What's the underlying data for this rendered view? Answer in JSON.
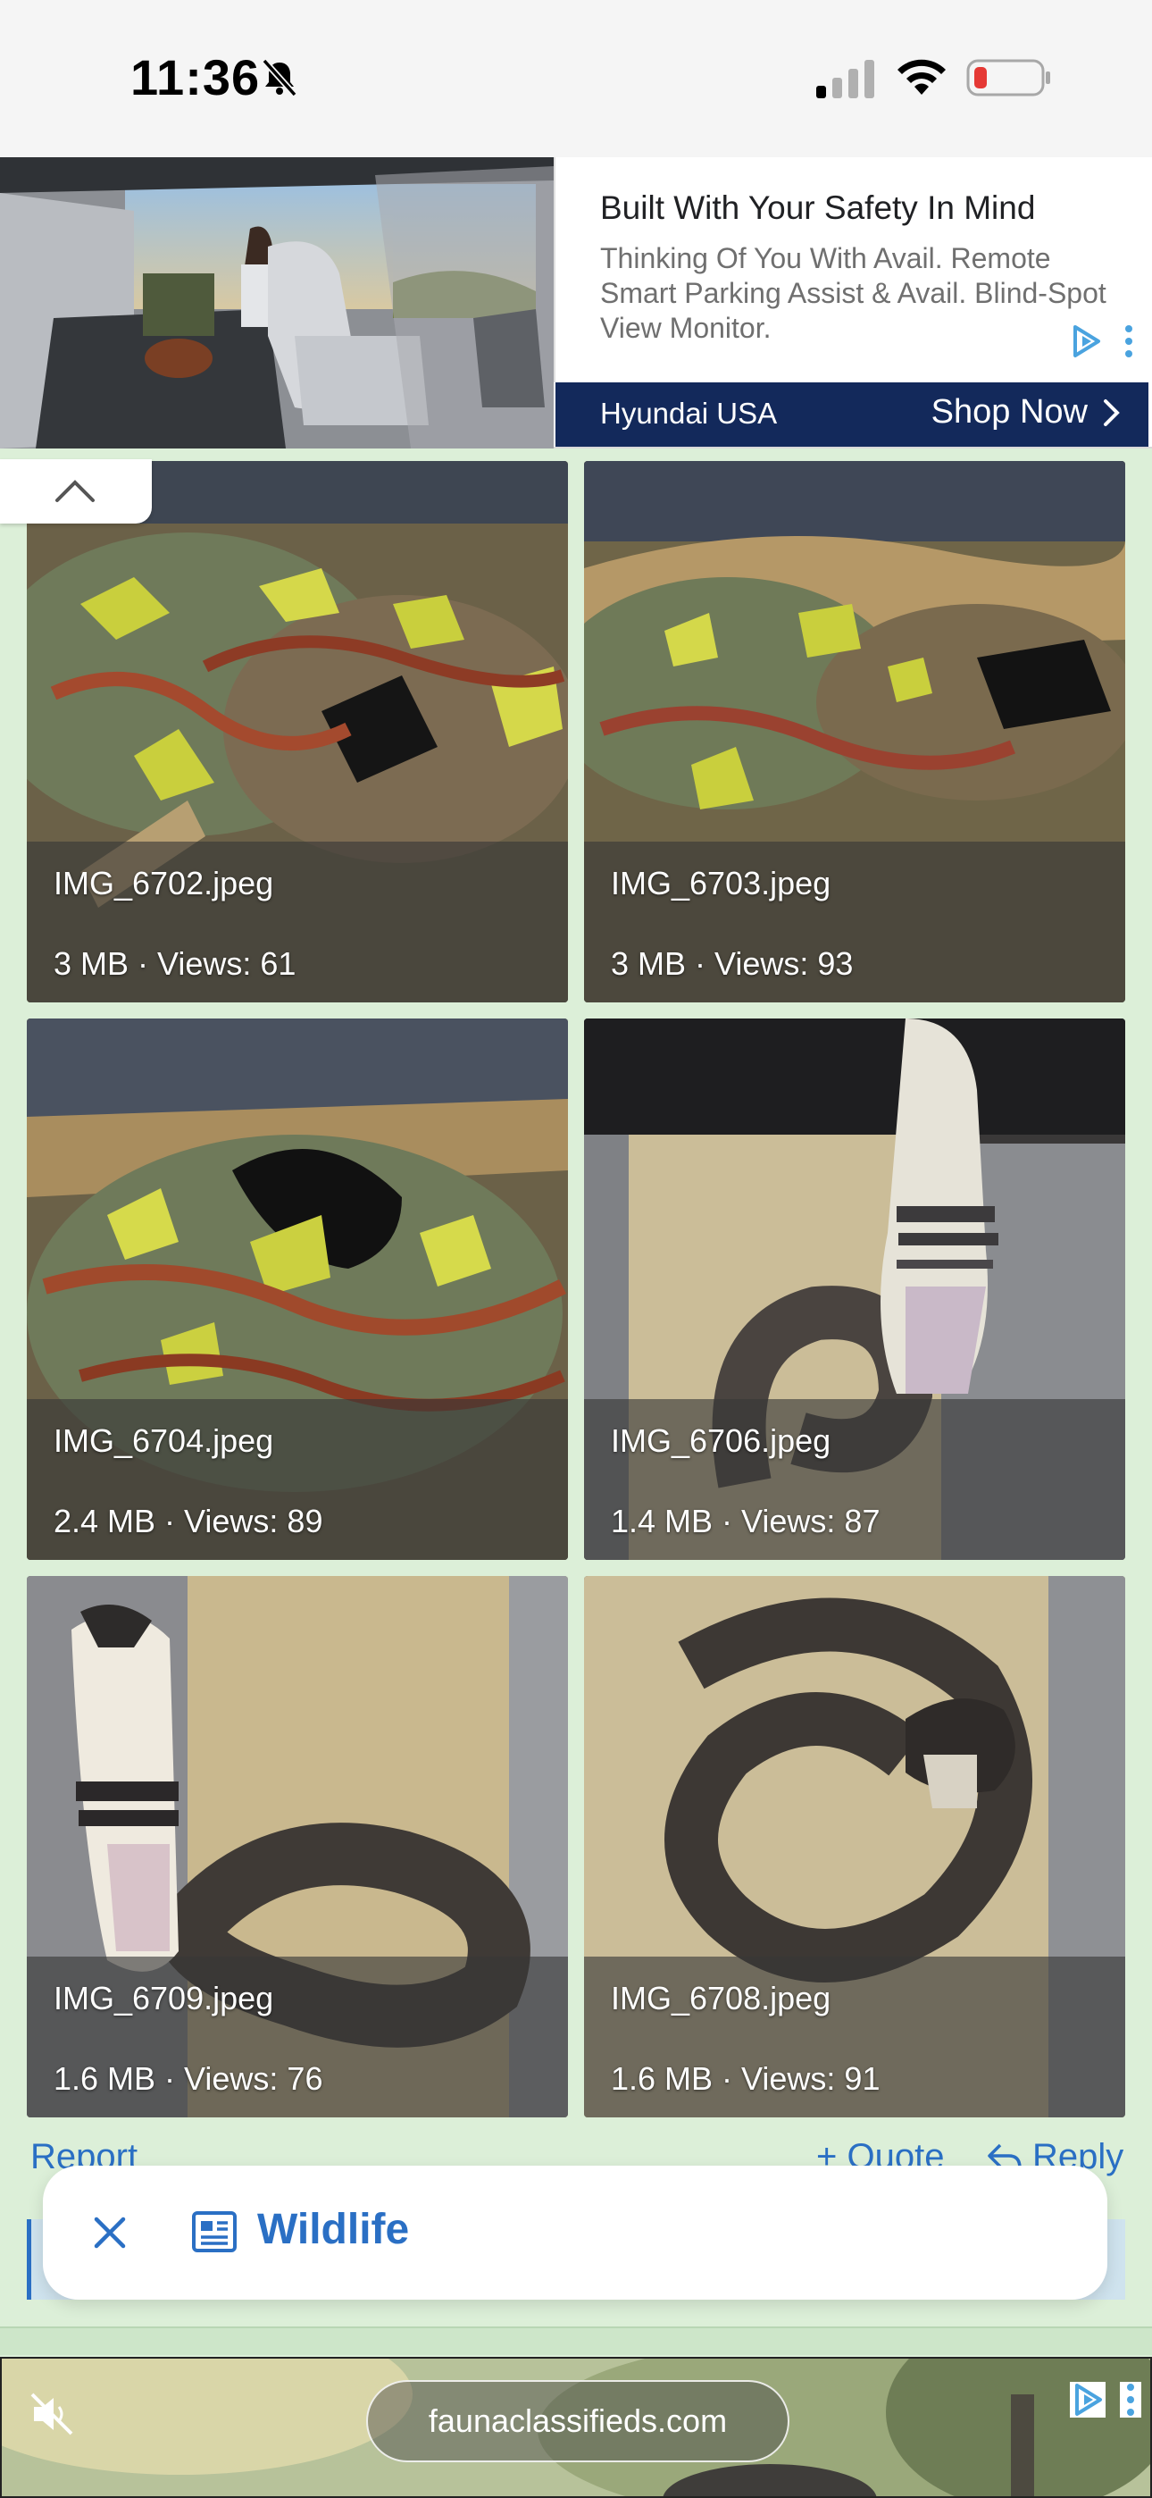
{
  "status_bar": {
    "time": "11:36",
    "icons": [
      "bell-slash-icon",
      "cellular-signal-icon",
      "wifi-icon",
      "battery-low-icon"
    ],
    "battery_color": "#e53935"
  },
  "ad_top": {
    "headline": "Built With Your Safety In Mind",
    "description": "Thinking Of You With Avail. Remote Smart Parking Assist & Avail. Blind-Spot View Monitor.",
    "advertiser": "Hyundai USA",
    "cta": "Shop Now",
    "bar_color": "#13295b"
  },
  "gallery": {
    "items": [
      {
        "name": "IMG_6702.jpeg",
        "meta": "3 MB · Views: 61"
      },
      {
        "name": "IMG_6703.jpeg",
        "meta": "3 MB · Views: 93"
      },
      {
        "name": "IMG_6704.jpeg",
        "meta": "2.4 MB · Views: 89"
      },
      {
        "name": "IMG_6706.jpeg",
        "meta": "1.4 MB · Views: 87"
      },
      {
        "name": "IMG_6709.jpeg",
        "meta": "1.6 MB · Views: 76"
      },
      {
        "name": "IMG_6708.jpeg",
        "meta": "1.6 MB · Views: 91"
      }
    ]
  },
  "actions": {
    "report": "Report",
    "quote": "+ Quote",
    "reply": "Reply"
  },
  "tag_bar": {
    "label": "Wildlife",
    "accent": "#2a6fc4"
  },
  "ad_bottom": {
    "url": "faunaclassifieds.com"
  }
}
